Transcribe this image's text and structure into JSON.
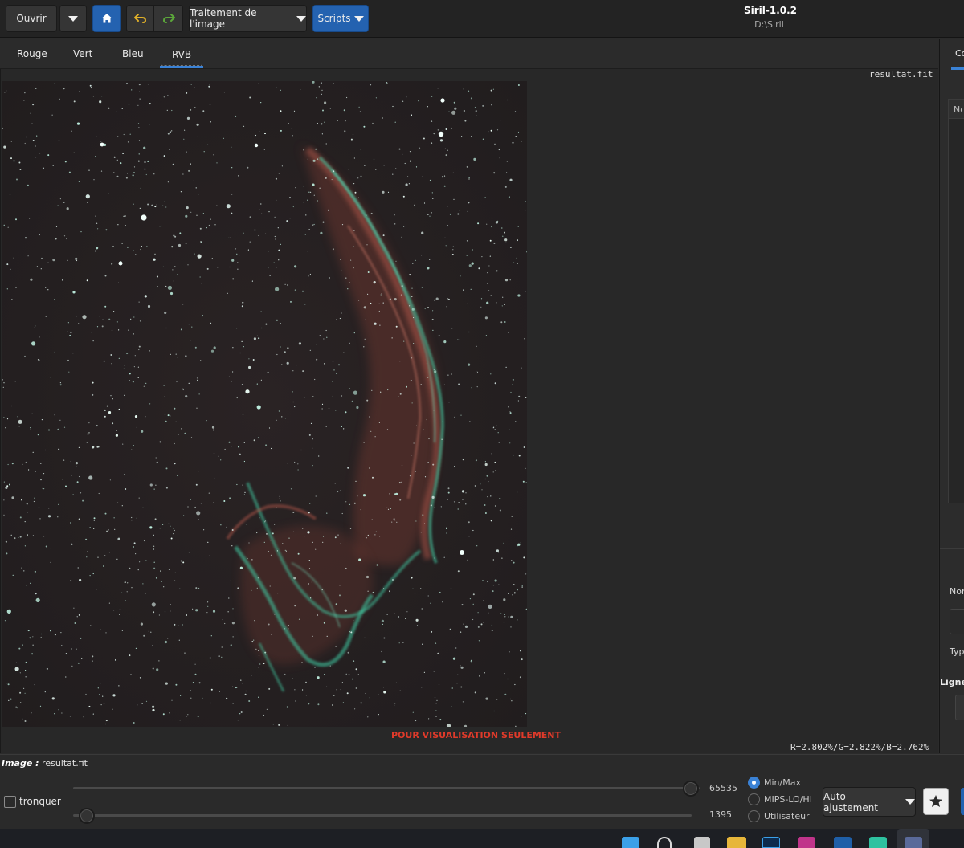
{
  "header": {
    "open_label": "Ouvrir",
    "processing_label": "Traitement de l'image",
    "scripts_label": "Scripts",
    "app_title": "Siril-1.0.2",
    "app_path": "D:\\SiriL"
  },
  "tabs": {
    "red": "Rouge",
    "green": "Vert",
    "blue": "Bleu",
    "rgb": "RVB"
  },
  "viewer": {
    "filename_overlay": "resultat.fit",
    "watermark": "POUR VISUALISATION SEULEMENT",
    "stats": "R=2.802%/G=2.822%/B=2.762%"
  },
  "right_panel": {
    "tab_fragment": "Co",
    "col_fragment": "Nc",
    "name_fragment": "Nor",
    "type_fragment": "Typ",
    "lines_fragment": "Ligne"
  },
  "bottom": {
    "image_label": "Image :",
    "image_name": "resultat.fit",
    "crop_label": "tronquer",
    "high_value": "65535",
    "low_value": "1395",
    "high_fraction": 1.0,
    "low_fraction": 0.0,
    "radio_options": [
      "Min/Max",
      "MIPS-LO/HI",
      "Utilisateur"
    ],
    "radio_selected": "Min/Max",
    "stretch_label": "Auto ajustement"
  },
  "colors": {
    "accent_blue": "#2462b0",
    "tab_underline": "#3a82d6",
    "watermark_red": "#e03a2a",
    "undo_yellow": "#e2b128",
    "redo_green": "#5ca83a",
    "nebula_teal": "#3fc9a2",
    "nebula_red": "#b0574a"
  },
  "taskbar": {
    "icons": [
      "windows-icon",
      "search-icon",
      "taskview-icon",
      "explorer-icon",
      "photoshop-icon",
      "camera-app-icon",
      "ccleaner-icon",
      "edge-icon",
      "siril-app-icon"
    ]
  }
}
